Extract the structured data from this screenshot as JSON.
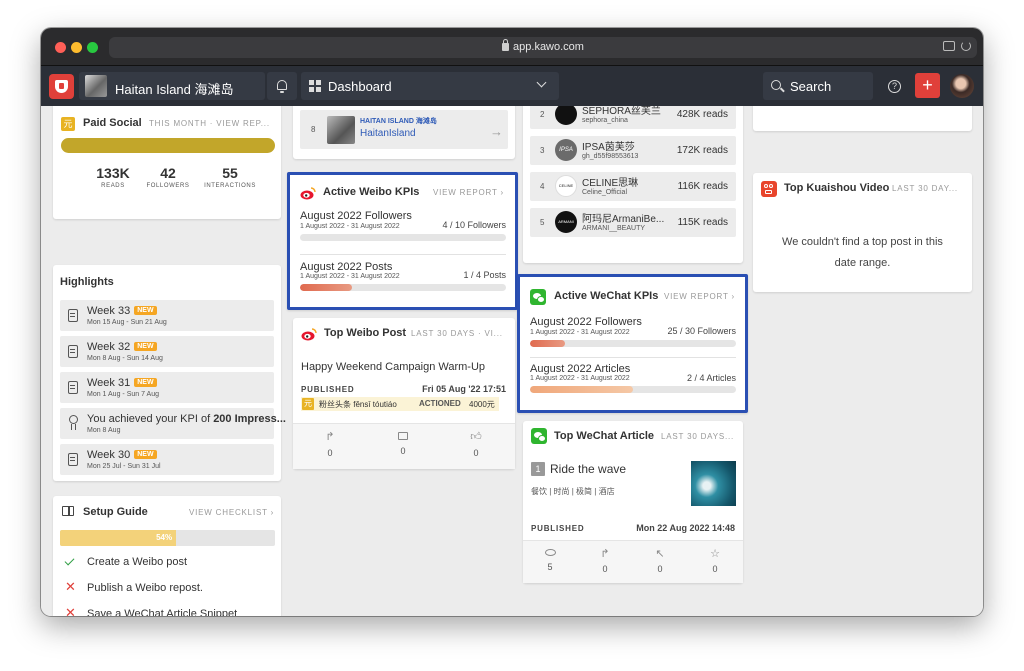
{
  "browser": {
    "url": "app.kawo.com"
  },
  "topbar": {
    "brand_name": "Haitan Island 海滩岛",
    "dashboard_label": "Dashboard",
    "search_label": "Search",
    "add_label": "+"
  },
  "paid_social": {
    "title": "Paid Social",
    "meta": "THIS MONTH · VIEW REP...",
    "stats": [
      {
        "value": "133K",
        "label": "READS"
      },
      {
        "value": "42",
        "label": "FOLLOWERS"
      },
      {
        "value": "55",
        "label": "INTERACTIONS"
      }
    ]
  },
  "highlights": {
    "title": "Highlights",
    "items": [
      {
        "title": "Week 33",
        "badge": "NEW",
        "sub": "Mon 15 Aug - Sun 21 Aug"
      },
      {
        "title": "Week 32",
        "badge": "NEW",
        "sub": "Mon 8 Aug - Sun 14 Aug"
      },
      {
        "title": "Week 31",
        "badge": "NEW",
        "sub": "Mon 1 Aug - Sun 7 Aug"
      },
      {
        "title_pre": "You achieved your KPI of ",
        "title_bold": "200 Impress...",
        "sub": "Mon 8 Aug"
      },
      {
        "title": "Week 30",
        "badge": "NEW",
        "sub": "Mon 25 Jul - Sun 31 Jul"
      }
    ]
  },
  "setup_guide": {
    "title": "Setup Guide",
    "link": "VIEW CHECKLIST ›",
    "progress_label": "54%",
    "progress_fraction": 0.54,
    "items": [
      {
        "label": "Create a Weibo post",
        "done": true
      },
      {
        "label": "Publish a Weibo repost.",
        "done": false
      },
      {
        "label": "Save a WeChat Article Snippet",
        "done": false
      }
    ]
  },
  "top_partial": {
    "rank": "8",
    "name_cn": "HAITAN ISLAND 海滩岛",
    "name": "HaitanIsland"
  },
  "weibo_kpis": {
    "title": "Active Weibo KPIs",
    "link": "VIEW REPORT ›",
    "kpis": [
      {
        "title": "August 2022 Followers",
        "dates": "1 August 2022 - 31 August 2022",
        "progress": "4 / 10 Followers",
        "fraction": 0.0
      },
      {
        "title": "August 2022 Posts",
        "dates": "1 August 2022 - 31 August 2022",
        "progress": "1 / 4 Posts",
        "fraction": 0.25
      }
    ]
  },
  "top_weibo_post": {
    "title": "Top Weibo Post",
    "meta": "LAST 30 DAYS · VI...",
    "post_title": "Happy Weekend Campaign Warm-Up",
    "status": "PUBLISHED",
    "date": "Fri 05 Aug '22 17:51",
    "promo_icon": "元",
    "promo_label": "粉丝头条 fěnsī tóutiáo",
    "promo_status": "ACTIONED",
    "promo_amount": "4000元",
    "actions": [
      {
        "icon": "repost-icon",
        "count": "0"
      },
      {
        "icon": "comment-icon",
        "count": "0"
      },
      {
        "icon": "like-icon",
        "count": "0"
      }
    ]
  },
  "leaderboard": {
    "rows": [
      {
        "rank": "2",
        "name": "SEPHORA丝芙兰",
        "handle": "sephora_china",
        "reads": "428K reads"
      },
      {
        "rank": "3",
        "name": "IPSA茵芙莎",
        "handle": "gh_d55f98553613",
        "reads": "172K reads",
        "avatar": "IPSA"
      },
      {
        "rank": "4",
        "name": "CELINE思琳",
        "handle": "Celine_Official",
        "reads": "116K reads",
        "avatar": "CELINE"
      },
      {
        "rank": "5",
        "name": "阿玛尼ArmaniBe...",
        "handle": "ARMANI__BEAUTY",
        "reads": "115K reads",
        "avatar": "ARMANI"
      }
    ]
  },
  "wechat_kpis": {
    "title": "Active WeChat KPIs",
    "link": "VIEW REPORT ›",
    "kpis": [
      {
        "title": "August 2022 Followers",
        "dates": "1 August 2022 - 31 August 2022",
        "progress": "25 / 30 Followers",
        "fraction": 0.17
      },
      {
        "title": "August 2022 Articles",
        "dates": "1 August 2022 - 31 August 2022",
        "progress": "2 / 4 Articles",
        "fraction": 0.5
      }
    ]
  },
  "top_wechat_article": {
    "title": "Top WeChat Article",
    "meta": "LAST 30 DAYS...",
    "rank": "1",
    "article_title": "Ride the wave",
    "tags": "餐饮 | 时尚 | 极简 | 酒店",
    "status": "PUBLISHED",
    "date": "Mon 22 Aug 2022 14:48",
    "actions": [
      {
        "icon": "eye-icon",
        "count": "5"
      },
      {
        "icon": "share-icon",
        "count": "0"
      },
      {
        "icon": "click-icon",
        "count": "0"
      },
      {
        "icon": "star-icon",
        "count": "0"
      }
    ]
  },
  "top_kuaishou": {
    "title": "Top Kuaishou Video",
    "meta": "LAST 30 DAY...",
    "empty_line1": "We couldn't find a top post in this",
    "empty_line2": "date range."
  },
  "colors": {
    "accent_red": "#e0403a",
    "paid_bar": "#c2a62a",
    "highlight_border": "#2a4fb3",
    "badge_orange": "#f5a623",
    "wechat_green": "#2fb52f"
  }
}
